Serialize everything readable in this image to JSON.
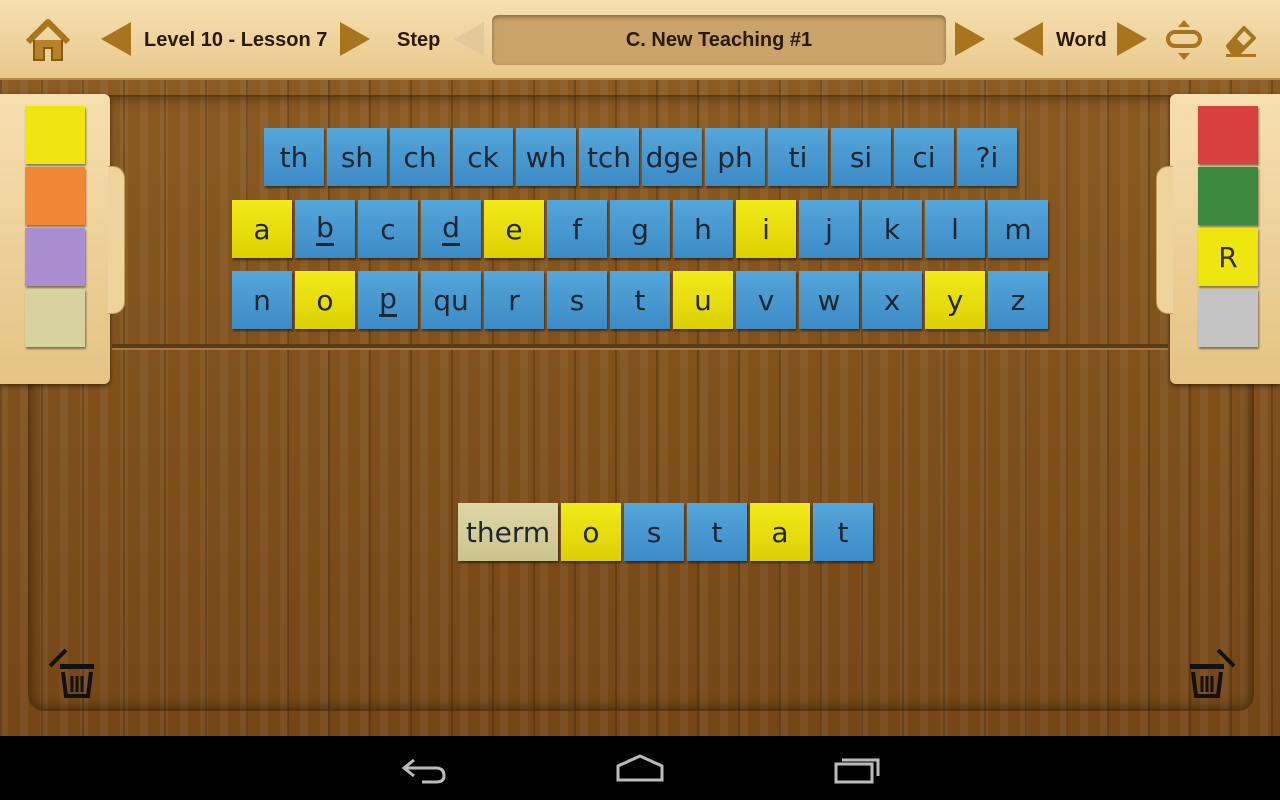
{
  "toolbar": {
    "lesson_label": "Level 10 - Lesson 7",
    "step_label": "Step",
    "step_value": "C. New Teaching #1",
    "word_label": "Word",
    "icons": [
      "home-icon",
      "prev-lesson-icon",
      "next-lesson-icon",
      "prev-step-icon",
      "next-step-icon",
      "prev-word-icon",
      "next-word-icon",
      "line-spacing-icon",
      "eraser-icon"
    ]
  },
  "letter_rows": [
    [
      {
        "text": "th",
        "color": "blue"
      },
      {
        "text": "sh",
        "color": "blue"
      },
      {
        "text": "ch",
        "color": "blue"
      },
      {
        "text": "ck",
        "color": "blue"
      },
      {
        "text": "wh",
        "color": "blue"
      },
      {
        "text": "tch",
        "color": "blue"
      },
      {
        "text": "dge",
        "color": "blue"
      },
      {
        "text": "ph",
        "color": "blue"
      },
      {
        "text": "ti",
        "color": "blue"
      },
      {
        "text": "si",
        "color": "blue"
      },
      {
        "text": "ci",
        "color": "blue"
      },
      {
        "text": "?i",
        "color": "blue"
      }
    ],
    [
      {
        "text": "a",
        "color": "yellow"
      },
      {
        "text": "b",
        "color": "blue",
        "underline": true
      },
      {
        "text": "c",
        "color": "blue"
      },
      {
        "text": "d",
        "color": "blue",
        "underline": true
      },
      {
        "text": "e",
        "color": "yellow"
      },
      {
        "text": "f",
        "color": "blue"
      },
      {
        "text": "g",
        "color": "blue"
      },
      {
        "text": "h",
        "color": "blue"
      },
      {
        "text": "i",
        "color": "yellow"
      },
      {
        "text": "j",
        "color": "blue"
      },
      {
        "text": "k",
        "color": "blue"
      },
      {
        "text": "l",
        "color": "blue"
      },
      {
        "text": "m",
        "color": "blue"
      }
    ],
    [
      {
        "text": "n",
        "color": "blue"
      },
      {
        "text": "o",
        "color": "yellow"
      },
      {
        "text": "p",
        "color": "blue",
        "underline": true
      },
      {
        "text": "qu",
        "color": "blue"
      },
      {
        "text": "r",
        "color": "blue"
      },
      {
        "text": "s",
        "color": "blue"
      },
      {
        "text": "t",
        "color": "blue"
      },
      {
        "text": "u",
        "color": "yellow"
      },
      {
        "text": "v",
        "color": "blue"
      },
      {
        "text": "w",
        "color": "blue"
      },
      {
        "text": "x",
        "color": "blue"
      },
      {
        "text": "y",
        "color": "yellow"
      },
      {
        "text": "z",
        "color": "blue"
      }
    ]
  ],
  "word_tiles": [
    {
      "text": "therm",
      "color": "khaki"
    },
    {
      "text": "o",
      "color": "yellow"
    },
    {
      "text": "s",
      "color": "blue"
    },
    {
      "text": "t",
      "color": "blue"
    },
    {
      "text": "a",
      "color": "yellow"
    },
    {
      "text": "t",
      "color": "blue"
    }
  ],
  "left_palette": [
    {
      "name": "yellow",
      "color": "#f0e60f"
    },
    {
      "name": "orange",
      "color": "#f0883a"
    },
    {
      "name": "purple",
      "color": "#a98fcf"
    },
    {
      "name": "khaki",
      "color": "#d8d2a0"
    }
  ],
  "right_palette": [
    {
      "name": "red",
      "color": "#d8403e",
      "label": ""
    },
    {
      "name": "green",
      "color": "#3b8a3e",
      "label": ""
    },
    {
      "name": "yellow",
      "color": "#f0e60f",
      "label": "R"
    },
    {
      "name": "gray",
      "color": "#c4c4c4",
      "label": ""
    }
  ],
  "colors": {
    "accent": "#a9741e",
    "tile_blue": "#4a98d0",
    "tile_yellow": "#eae012",
    "tile_khaki": "#d6d09c",
    "toolbar_bg": "#f2d9a6"
  },
  "navbar": {
    "icons": [
      "back-icon",
      "home-nav-icon",
      "recent-apps-icon"
    ]
  }
}
